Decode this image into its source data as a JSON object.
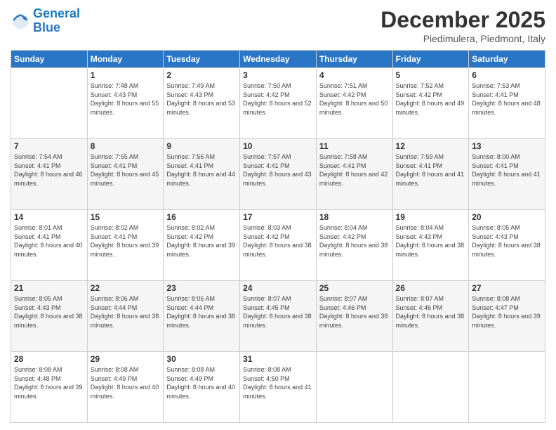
{
  "logo": {
    "line1": "General",
    "line2": "Blue"
  },
  "title": "December 2025",
  "subtitle": "Piedimulera, Piedmont, Italy",
  "days_of_week": [
    "Sunday",
    "Monday",
    "Tuesday",
    "Wednesday",
    "Thursday",
    "Friday",
    "Saturday"
  ],
  "weeks": [
    [
      {
        "day": "",
        "sunrise": "",
        "sunset": "",
        "daylight": ""
      },
      {
        "day": "1",
        "sunrise": "Sunrise: 7:48 AM",
        "sunset": "Sunset: 4:43 PM",
        "daylight": "Daylight: 8 hours and 55 minutes."
      },
      {
        "day": "2",
        "sunrise": "Sunrise: 7:49 AM",
        "sunset": "Sunset: 4:43 PM",
        "daylight": "Daylight: 8 hours and 53 minutes."
      },
      {
        "day": "3",
        "sunrise": "Sunrise: 7:50 AM",
        "sunset": "Sunset: 4:42 PM",
        "daylight": "Daylight: 8 hours and 52 minutes."
      },
      {
        "day": "4",
        "sunrise": "Sunrise: 7:51 AM",
        "sunset": "Sunset: 4:42 PM",
        "daylight": "Daylight: 8 hours and 50 minutes."
      },
      {
        "day": "5",
        "sunrise": "Sunrise: 7:52 AM",
        "sunset": "Sunset: 4:42 PM",
        "daylight": "Daylight: 8 hours and 49 minutes."
      },
      {
        "day": "6",
        "sunrise": "Sunrise: 7:53 AM",
        "sunset": "Sunset: 4:41 PM",
        "daylight": "Daylight: 8 hours and 48 minutes."
      }
    ],
    [
      {
        "day": "7",
        "sunrise": "Sunrise: 7:54 AM",
        "sunset": "Sunset: 4:41 PM",
        "daylight": "Daylight: 8 hours and 46 minutes."
      },
      {
        "day": "8",
        "sunrise": "Sunrise: 7:55 AM",
        "sunset": "Sunset: 4:41 PM",
        "daylight": "Daylight: 8 hours and 45 minutes."
      },
      {
        "day": "9",
        "sunrise": "Sunrise: 7:56 AM",
        "sunset": "Sunset: 4:41 PM",
        "daylight": "Daylight: 8 hours and 44 minutes."
      },
      {
        "day": "10",
        "sunrise": "Sunrise: 7:57 AM",
        "sunset": "Sunset: 4:41 PM",
        "daylight": "Daylight: 8 hours and 43 minutes."
      },
      {
        "day": "11",
        "sunrise": "Sunrise: 7:58 AM",
        "sunset": "Sunset: 4:41 PM",
        "daylight": "Daylight: 8 hours and 42 minutes."
      },
      {
        "day": "12",
        "sunrise": "Sunrise: 7:59 AM",
        "sunset": "Sunset: 4:41 PM",
        "daylight": "Daylight: 8 hours and 41 minutes."
      },
      {
        "day": "13",
        "sunrise": "Sunrise: 8:00 AM",
        "sunset": "Sunset: 4:41 PM",
        "daylight": "Daylight: 8 hours and 41 minutes."
      }
    ],
    [
      {
        "day": "14",
        "sunrise": "Sunrise: 8:01 AM",
        "sunset": "Sunset: 4:41 PM",
        "daylight": "Daylight: 8 hours and 40 minutes."
      },
      {
        "day": "15",
        "sunrise": "Sunrise: 8:02 AM",
        "sunset": "Sunset: 4:41 PM",
        "daylight": "Daylight: 8 hours and 39 minutes."
      },
      {
        "day": "16",
        "sunrise": "Sunrise: 8:02 AM",
        "sunset": "Sunset: 4:42 PM",
        "daylight": "Daylight: 8 hours and 39 minutes."
      },
      {
        "day": "17",
        "sunrise": "Sunrise: 8:03 AM",
        "sunset": "Sunset: 4:42 PM",
        "daylight": "Daylight: 8 hours and 38 minutes."
      },
      {
        "day": "18",
        "sunrise": "Sunrise: 8:04 AM",
        "sunset": "Sunset: 4:42 PM",
        "daylight": "Daylight: 8 hours and 38 minutes."
      },
      {
        "day": "19",
        "sunrise": "Sunrise: 8:04 AM",
        "sunset": "Sunset: 4:43 PM",
        "daylight": "Daylight: 8 hours and 38 minutes."
      },
      {
        "day": "20",
        "sunrise": "Sunrise: 8:05 AM",
        "sunset": "Sunset: 4:43 PM",
        "daylight": "Daylight: 8 hours and 38 minutes."
      }
    ],
    [
      {
        "day": "21",
        "sunrise": "Sunrise: 8:05 AM",
        "sunset": "Sunset: 4:43 PM",
        "daylight": "Daylight: 8 hours and 38 minutes."
      },
      {
        "day": "22",
        "sunrise": "Sunrise: 8:06 AM",
        "sunset": "Sunset: 4:44 PM",
        "daylight": "Daylight: 8 hours and 38 minutes."
      },
      {
        "day": "23",
        "sunrise": "Sunrise: 8:06 AM",
        "sunset": "Sunset: 4:44 PM",
        "daylight": "Daylight: 8 hours and 38 minutes."
      },
      {
        "day": "24",
        "sunrise": "Sunrise: 8:07 AM",
        "sunset": "Sunset: 4:45 PM",
        "daylight": "Daylight: 8 hours and 38 minutes."
      },
      {
        "day": "25",
        "sunrise": "Sunrise: 8:07 AM",
        "sunset": "Sunset: 4:46 PM",
        "daylight": "Daylight: 8 hours and 38 minutes."
      },
      {
        "day": "26",
        "sunrise": "Sunrise: 8:07 AM",
        "sunset": "Sunset: 4:46 PM",
        "daylight": "Daylight: 8 hours and 38 minutes."
      },
      {
        "day": "27",
        "sunrise": "Sunrise: 8:08 AM",
        "sunset": "Sunset: 4:47 PM",
        "daylight": "Daylight: 8 hours and 39 minutes."
      }
    ],
    [
      {
        "day": "28",
        "sunrise": "Sunrise: 8:08 AM",
        "sunset": "Sunset: 4:48 PM",
        "daylight": "Daylight: 8 hours and 39 minutes."
      },
      {
        "day": "29",
        "sunrise": "Sunrise: 8:08 AM",
        "sunset": "Sunset: 4:49 PM",
        "daylight": "Daylight: 8 hours and 40 minutes."
      },
      {
        "day": "30",
        "sunrise": "Sunrise: 8:08 AM",
        "sunset": "Sunset: 4:49 PM",
        "daylight": "Daylight: 8 hours and 40 minutes."
      },
      {
        "day": "31",
        "sunrise": "Sunrise: 8:08 AM",
        "sunset": "Sunset: 4:50 PM",
        "daylight": "Daylight: 8 hours and 41 minutes."
      },
      {
        "day": "",
        "sunrise": "",
        "sunset": "",
        "daylight": ""
      },
      {
        "day": "",
        "sunrise": "",
        "sunset": "",
        "daylight": ""
      },
      {
        "day": "",
        "sunrise": "",
        "sunset": "",
        "daylight": ""
      }
    ]
  ]
}
